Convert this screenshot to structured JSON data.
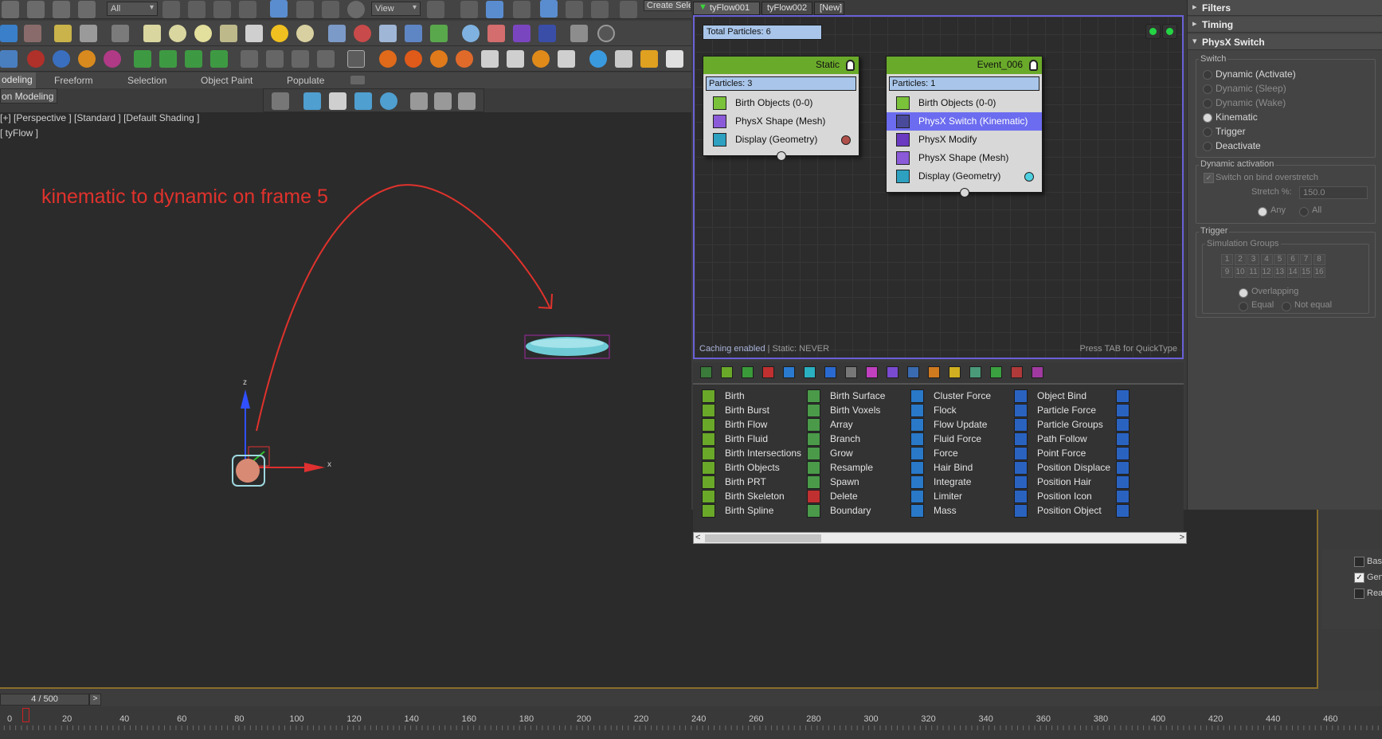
{
  "toolbar": {
    "selection_filter": "All",
    "reference_coord": "View",
    "create_selection_set": "Create Selection Se"
  },
  "ribbon": {
    "tabs": [
      "odeling",
      "Freeform",
      "Selection",
      "Object Paint",
      "Populate"
    ],
    "panel_label": "on Modeling"
  },
  "viewport": {
    "label": "[+] [Perspective ] [Standard ] [Default Shading ]",
    "object_name": "[ tyFlow ]",
    "annotation": "kinematic to dynamic on frame 5",
    "axis_x": "x",
    "axis_z": "z",
    "colors": {
      "annotation": "#e0322c",
      "disc": "#6ecbd6",
      "selection": "#a02aa0"
    }
  },
  "tyflow": {
    "tabs": [
      "tyFlow001",
      "tyFlow002",
      "[New]"
    ],
    "total_particles": "Total Particles: 6",
    "events": [
      {
        "title": "Static",
        "particles": "Particles: 3",
        "operators": [
          {
            "label": "Birth Objects (0-0)",
            "icon": "birth-objects-icon",
            "selected": false
          },
          {
            "label": "PhysX Shape (Mesh)",
            "icon": "physx-shape-icon",
            "selected": false
          },
          {
            "label": "Display (Geometry)",
            "icon": "display-icon",
            "selected": false,
            "swatch": "#b0504a"
          }
        ]
      },
      {
        "title": "Event_006",
        "particles": "Particles: 1",
        "operators": [
          {
            "label": "Birth Objects (0-0)",
            "icon": "birth-objects-icon",
            "selected": false
          },
          {
            "label": "PhysX Switch (Kinematic)",
            "icon": "physx-switch-icon",
            "selected": true
          },
          {
            "label": "PhysX Modify",
            "icon": "physx-modify-icon",
            "selected": false
          },
          {
            "label": "PhysX Shape (Mesh)",
            "icon": "physx-shape-icon",
            "selected": false
          },
          {
            "label": "Display (Geometry)",
            "icon": "display-icon",
            "selected": false,
            "swatch": "#4fd0e0"
          }
        ]
      }
    ],
    "status_caching": "Caching enabled",
    "status_static": " | Static: NEVER",
    "quicktype_hint": "Press TAB for QuickType",
    "palette_columns": [
      [
        "Birth",
        "Birth Burst",
        "Birth Flow",
        "Birth Fluid",
        "Birth Intersections",
        "Birth Objects",
        "Birth PRT",
        "Birth Skeleton",
        "Birth Spline"
      ],
      [
        "Birth Surface",
        "Birth Voxels",
        "Array",
        "Branch",
        "Grow",
        "Resample",
        "Spawn",
        "Delete",
        "Boundary"
      ],
      [
        "Cluster Force",
        "Flock",
        "Flow Update",
        "Fluid Force",
        "Force",
        "Hair Bind",
        "Integrate",
        "Limiter",
        "Mass"
      ],
      [
        "Object Bind",
        "Particle Force",
        "Particle Groups",
        "Path Follow",
        "Point Force",
        "Position Displace",
        "Position Hair",
        "Position Icon",
        "Position Object"
      ]
    ],
    "colors": {
      "event_header": "#6aaa2a",
      "particle_count": "#a9c6ea",
      "selected_operator": "#6c6cf0",
      "canvas_border": "#6a60d8"
    }
  },
  "command_panel": {
    "rollouts": [
      "Filters",
      "Timing",
      "PhysX Switch"
    ],
    "switch_label": "Switch",
    "switch_options": [
      {
        "label": "Dynamic (Activate)",
        "enabled": true,
        "checked": false
      },
      {
        "label": "Dynamic (Sleep)",
        "enabled": false,
        "checked": false
      },
      {
        "label": "Dynamic (Wake)",
        "enabled": false,
        "checked": false
      },
      {
        "label": "Kinematic",
        "enabled": true,
        "checked": true
      },
      {
        "label": "Trigger",
        "enabled": true,
        "checked": false
      },
      {
        "label": "Deactivate",
        "enabled": true,
        "checked": false
      }
    ],
    "dynamic_activation_label": "Dynamic activation",
    "switch_on_bind": "Switch on bind overstretch",
    "stretch_label": "Stretch %:",
    "stretch_value": "150.0",
    "any_label": "Any",
    "all_label": "All",
    "trigger_label": "Trigger",
    "simulation_groups_label": "Simulation Groups",
    "groups": [
      "1",
      "2",
      "3",
      "4",
      "5",
      "6",
      "7",
      "8",
      "9",
      "10",
      "11",
      "12",
      "13",
      "14",
      "15",
      "16"
    ],
    "overlapping_label": "Overlapping",
    "equal_label": "Equal",
    "not_equal_label": "Not equal"
  },
  "lower_right": {
    "items": [
      {
        "label": "Base",
        "checked": false
      },
      {
        "label": "Gen",
        "checked": true
      },
      {
        "label": "Rea",
        "checked": false
      }
    ]
  },
  "timeline": {
    "slider": "4 / 500",
    "next": ">",
    "ticks": [
      "0",
      "20",
      "40",
      "60",
      "80",
      "100",
      "120",
      "140",
      "160",
      "180",
      "200",
      "220",
      "240",
      "260",
      "280",
      "300",
      "320",
      "340",
      "360",
      "380",
      "400",
      "420",
      "440",
      "460"
    ]
  }
}
